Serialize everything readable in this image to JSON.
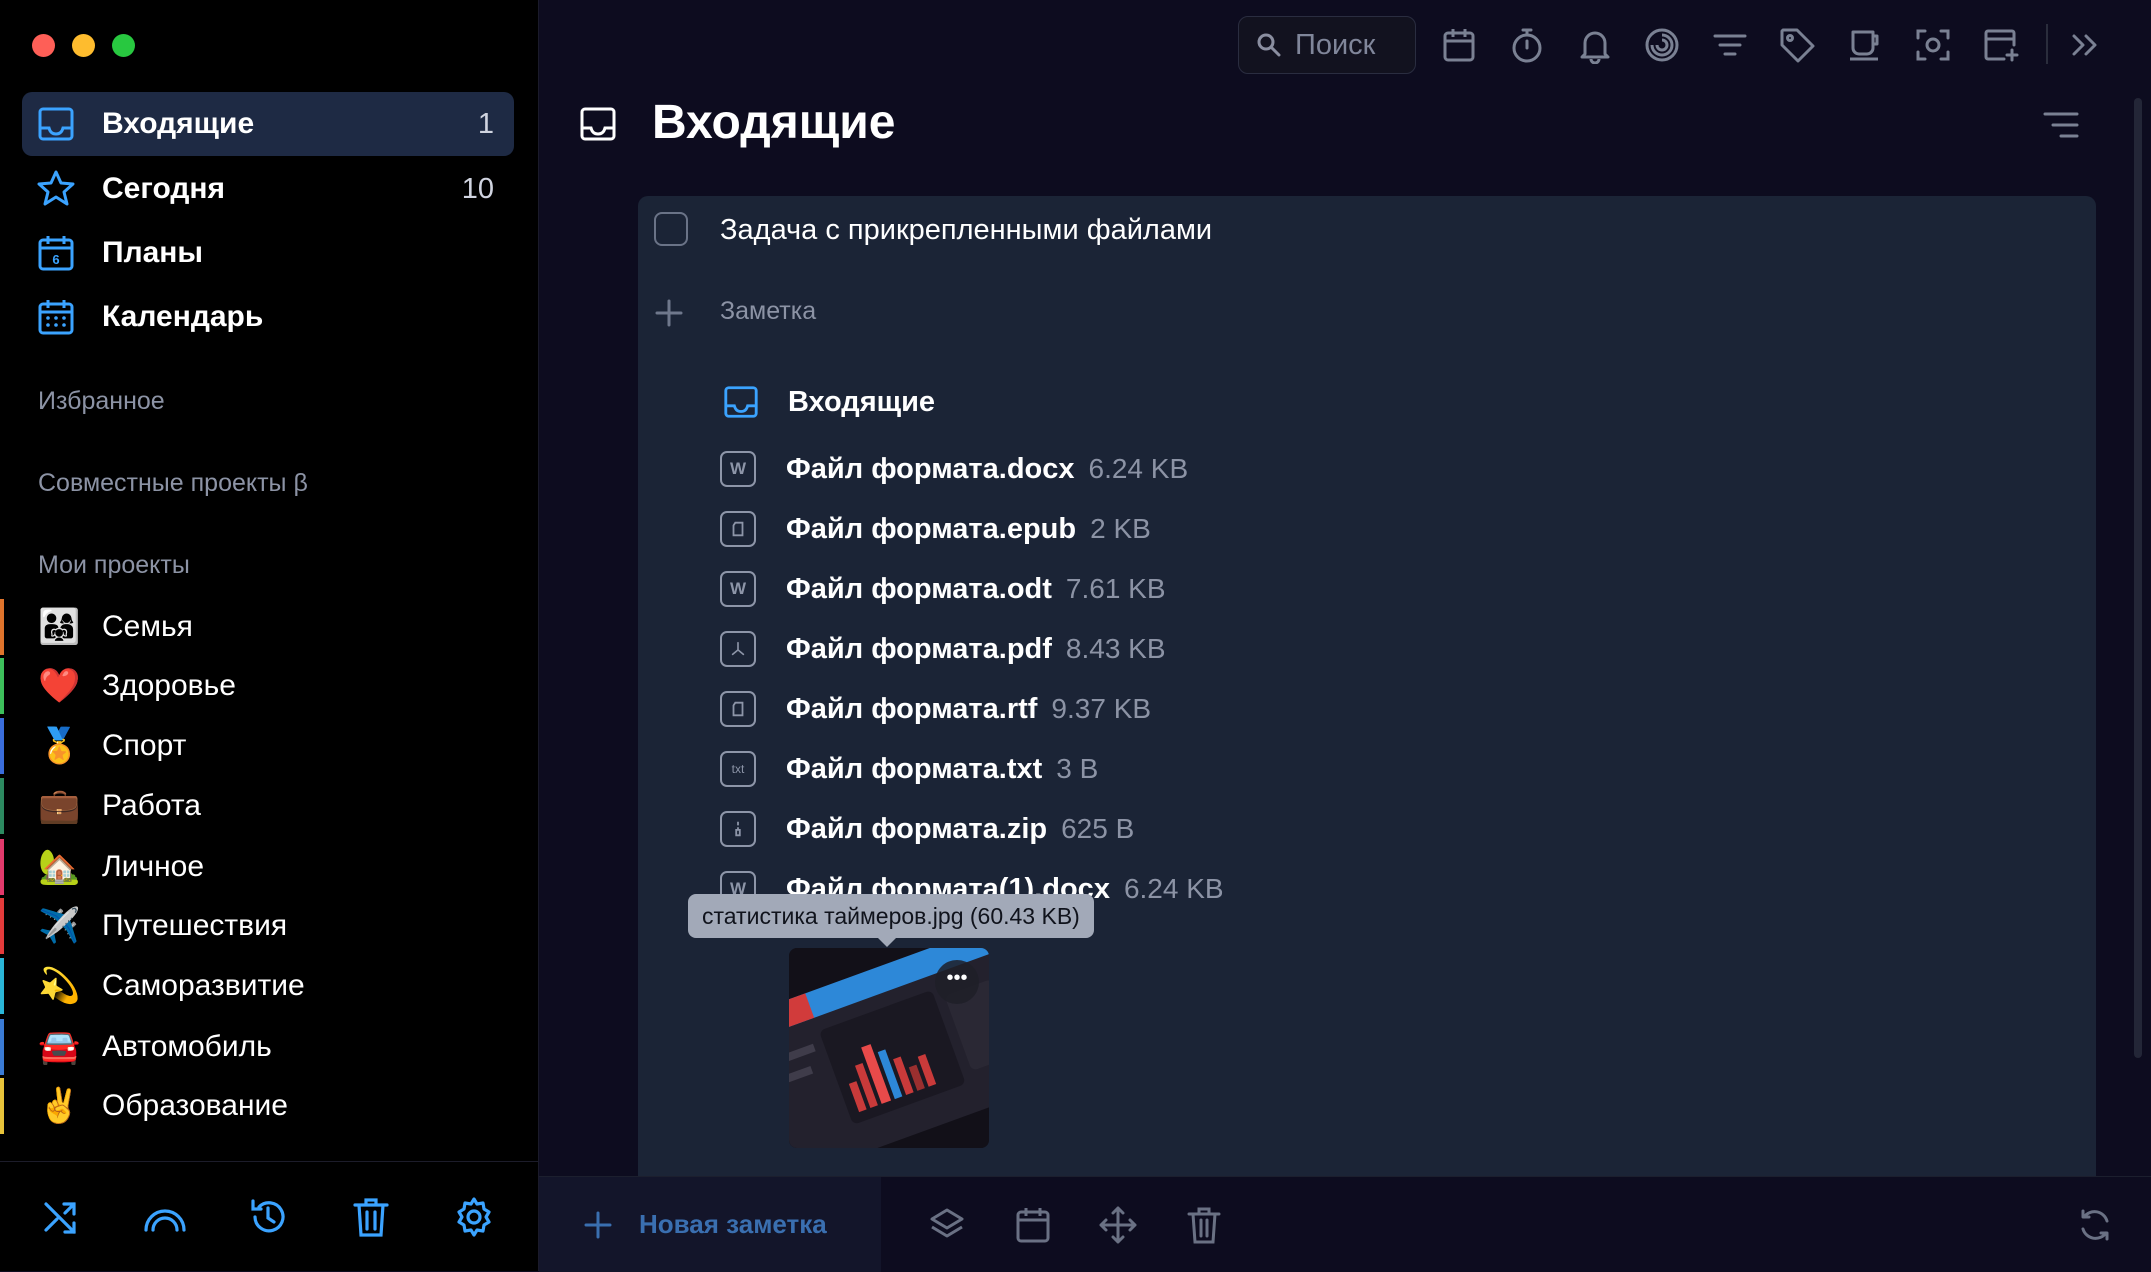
{
  "sidebar": {
    "nav": [
      {
        "label": "Входящие",
        "count": "1",
        "icon": "inbox-icon"
      },
      {
        "label": "Сегодня",
        "count": "10",
        "icon": "star-icon"
      },
      {
        "label": "Планы",
        "count": "",
        "icon": "calendar-day-icon"
      },
      {
        "label": "Календарь",
        "count": "",
        "icon": "calendar-grid-icon"
      }
    ],
    "sections": {
      "favorites": "Избранное",
      "shared": "Совместные проекты β",
      "my_projects": "Мои проекты"
    },
    "projects": [
      {
        "label": "Семья",
        "emoji": "👨‍👩‍👧",
        "color": "#e0742c"
      },
      {
        "label": "Здоровье",
        "emoji": "❤️",
        "color": "#3dbf5b"
      },
      {
        "label": "Спорт",
        "emoji": "🏅",
        "color": "#3a6ddb"
      },
      {
        "label": "Работа",
        "emoji": "💼",
        "color": "#2c8a60"
      },
      {
        "label": "Личное",
        "emoji": "🏡",
        "color": "#e23a6c"
      },
      {
        "label": "Путешествия",
        "emoji": "✈️",
        "color": "#e43b3b"
      },
      {
        "label": "Саморазвитие",
        "emoji": "💫",
        "color": "#2ab6d8"
      },
      {
        "label": "Автомобиль",
        "emoji": "🚘",
        "color": "#3a7bd5"
      },
      {
        "label": "Образование",
        "emoji": "✌️",
        "color": "#e8c33a"
      }
    ],
    "bottom_icons": [
      "shuffle-icon",
      "rainbow-icon",
      "history-icon",
      "trash-icon",
      "settings-icon"
    ]
  },
  "topbar": {
    "search_placeholder": "Поиск",
    "icons": [
      "calendar-icon",
      "timer-icon",
      "bell-icon",
      "focus-icon",
      "filter-icon",
      "tag-icon",
      "cup-icon",
      "screenshot-icon",
      "add-window-icon",
      "collapse-icon"
    ]
  },
  "main": {
    "title": "Входящие",
    "task": {
      "title": "Задача с прикрепленными файлами",
      "note_label": "Заметка",
      "project": "Входящие",
      "files": [
        {
          "name": "Файл формата.docx",
          "size": "6.24 KB",
          "icon": "word-icon",
          "glyph": "W"
        },
        {
          "name": "Файл формата.epub",
          "size": "2 KB",
          "icon": "document-icon",
          "glyph": ""
        },
        {
          "name": "Файл формата.odt",
          "size": "7.61 KB",
          "icon": "word-icon",
          "glyph": "W"
        },
        {
          "name": "Файл формата.pdf",
          "size": "8.43 KB",
          "icon": "pdf-icon",
          "glyph": ""
        },
        {
          "name": "Файл формата.rtf",
          "size": "9.37 KB",
          "icon": "document-icon",
          "glyph": ""
        },
        {
          "name": "Файл формата.txt",
          "size": "3 B",
          "icon": "txt-icon",
          "glyph": "txt"
        },
        {
          "name": "Файл формата.zip",
          "size": "625 B",
          "icon": "zip-icon",
          "glyph": ""
        },
        {
          "name": "Файл формата(1).docx",
          "size": "6.24 KB",
          "icon": "word-icon",
          "glyph": "W"
        }
      ],
      "image_tooltip": "статистика таймеров.jpg (60.43 KB)"
    }
  },
  "bottombar": {
    "new_note": "Новая заметка",
    "icons": [
      "layers-icon",
      "calendar-icon",
      "move-icon",
      "trash-icon",
      "sync-icon"
    ]
  },
  "colors": {
    "accent": "#3ba3ff",
    "sidebar_bg": "#000000",
    "main_bg": "#0d0c1f",
    "panel_bg": "#1b2436",
    "active_item_bg": "#1e2a44"
  }
}
